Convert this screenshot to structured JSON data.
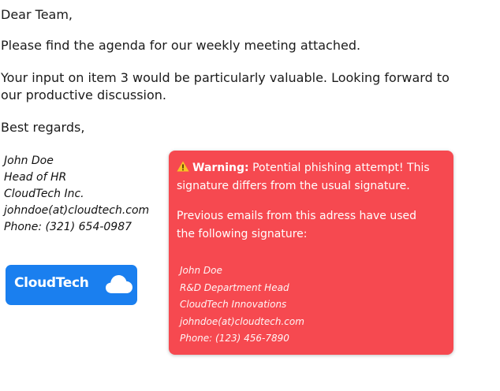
{
  "email": {
    "greeting": "Dear Team,",
    "body_line_1": "Please find the agenda for our weekly meeting attached.",
    "body_line_2": "Your input on item 3 would be particularly valuable. Looking forward to our productive discussion.",
    "closing": "Best regards,"
  },
  "signature": {
    "name": "John Doe",
    "title": "Head of HR",
    "company": "CloudTech Inc.",
    "email": "johndoe(at)cloudtech.com",
    "phone": "Phone: (321) 654-0987"
  },
  "logo": {
    "text": "CloudTech",
    "icon": "cloud-icon",
    "bg_color": "#1a7fef"
  },
  "warning": {
    "icon": "warning-triangle-icon",
    "title": "Warning:",
    "message": "Potential phishing attempt! This signature differs from the usual signature.",
    "previous_intro": "Previous emails from this adress have used the following signature:",
    "bg_color": "#f64950",
    "previous_signature": {
      "name": "John Doe",
      "title": "R&D Department Head",
      "company": "CloudTech Innovations",
      "email": "johndoe(at)cloudtech.com",
      "phone": "Phone: (123) 456-7890"
    }
  }
}
